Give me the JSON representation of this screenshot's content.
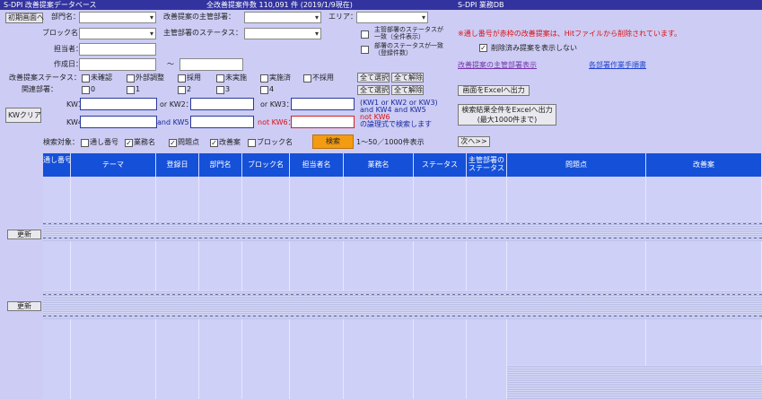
{
  "app": {
    "title": "S-DPI 改善提案データベース",
    "total_count_label": "全改善提案件数 110,091 件 (2019/1/9現在)",
    "right_title": "S-DPI 業務DB"
  },
  "colors": {
    "topbar": "#3333a0",
    "header": "#1550d8",
    "search_button": "#f39c12",
    "background": "#ccccf5"
  },
  "buttons": {
    "init_screen": "初期画面へ",
    "kw_clear": "KWクリア",
    "select_all": "全て選択",
    "clear_all": "全て解除",
    "excel_screen": "画面をExcelへ出力",
    "excel_all": "検索結果全件をExcelへ出力",
    "excel_all_sub": "(最大1000件まで)",
    "search": "検索",
    "next": "次へ>>",
    "update": "更新"
  },
  "form": {
    "dept_label": "部門名：",
    "block_label": "ブロック名：",
    "owner_label": "担当者：",
    "created_label": "作成日：",
    "created_sep": "～",
    "dept_manage_label": "改善提案の主管部署：",
    "area_label": "エリア：",
    "status_label": "主管部署のステータス：",
    "chk_sub1": "主管部署のステータスが一致（全件表示）",
    "chk_sub2": "部署のステータスが一致（登録件数）",
    "note_red": "※通し番号が赤枠の改善提案は、Hitファイルから削除されています。",
    "hide_deleted": "削除済み提案を表示しない",
    "link_dept": "改善提案の主管部署表示",
    "link_manual": "各部署作業手順書",
    "status_row_label": "改善提案ステータス：",
    "status_options": [
      "未確認",
      "外部調整",
      "採用",
      "未実施",
      "実施済",
      "不採用"
    ],
    "related_label": "関連部署：",
    "related_options": [
      "0",
      "1",
      "2",
      "3",
      "4"
    ],
    "kw1_label": "KW1：",
    "kw_or1": "or KW2：",
    "kw_or2": "or KW3：",
    "kw4_label": "KW4：",
    "kw_and": "and KW5：",
    "kw_not": "not KW6：",
    "kw_note1": "(KW1 or KW2 or KW3)",
    "kw_note2": "and KW4 and KW5",
    "kw_note3": "not KW6",
    "kw_note4": "の論理式で検索します",
    "target_label": "検索対象：",
    "targets": [
      {
        "label": "通し番号",
        "checked": false
      },
      {
        "label": "業務名",
        "checked": true
      },
      {
        "label": "問題点",
        "checked": true
      },
      {
        "label": "改善案",
        "checked": true
      },
      {
        "label": "ブロック名",
        "checked": false
      }
    ],
    "range_text": "1～50／1000件表示"
  },
  "table": {
    "columns": [
      "通し番号",
      "テーマ",
      "登録日",
      "部門名",
      "ブロック名",
      "担当者名",
      "業務名",
      "ステータス",
      "主管部署のステータス",
      "問題点",
      "改善案"
    ]
  }
}
